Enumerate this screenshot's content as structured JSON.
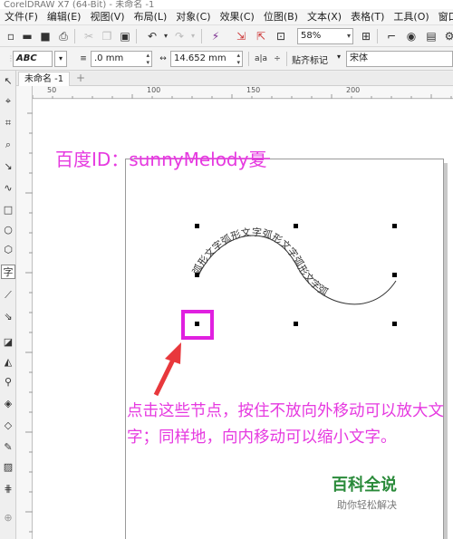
{
  "window": {
    "title": "CorelDRAW X7 (64-Bit) - 未命名 -1"
  },
  "menu": [
    "文件(F)",
    "编辑(E)",
    "视图(V)",
    "布局(L)",
    "对象(C)",
    "效果(C)",
    "位图(B)",
    "文本(X)",
    "表格(T)",
    "工具(O)",
    "窗口(W)"
  ],
  "toolbar": {
    "zoom": "58%"
  },
  "propbar": {
    "indent_value": ".0 mm",
    "offset_value": "14.652 mm",
    "snap_label": "贴齐标记",
    "font_name": "宋体"
  },
  "tab": {
    "name": "未命名 -1",
    "add": "+"
  },
  "ruler": {
    "corner": "☼",
    "ticks": [
      "50",
      "100",
      "150",
      "200"
    ]
  },
  "canvas": {
    "heading": "百度ID：sunnyMelody夏",
    "path_text": "弧形文字弧形文字弧形文字弧形文字弧",
    "caption": "点击这些节点，按住不放向外移动可以放大文字；同样地，向内移动可以缩小文字。"
  },
  "watermark": {
    "title": "百科全说",
    "subtitle": "助你轻松解决"
  },
  "colors": {
    "accent": "#e63ae0",
    "box": "#e020e0",
    "arrow": "#e8383c",
    "watermark": "#2a8a3a"
  }
}
